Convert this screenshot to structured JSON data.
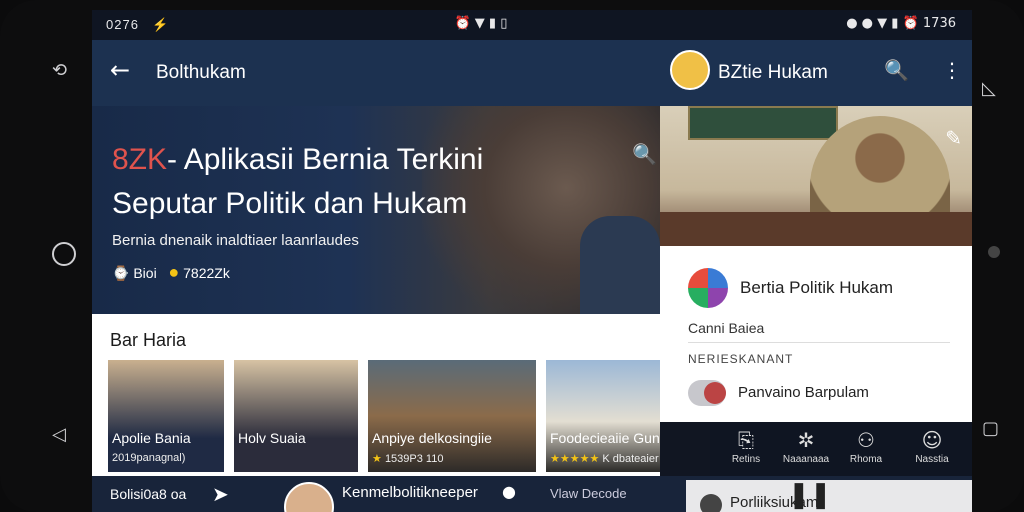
{
  "status_bar": {
    "time": "0276",
    "right_text": "1736"
  },
  "left": {
    "topbar_title": "Bolthukam",
    "hero": {
      "title_red": "8ZK",
      "title_rest": "- Aplikasii Bernia Terkini Seputar Politik dan Hukam",
      "subtitle": "Bernia dnenaik inaldtiaer laanrlaudes",
      "meta_left": "Bioi",
      "meta_right": "7822Zk"
    },
    "news_heading": "Bar Haria",
    "cards": [
      {
        "caption": "Apolie Bania",
        "sub": "2019panagnal)"
      },
      {
        "caption": "Holv Suaia",
        "sub": ""
      },
      {
        "caption": "Anpiye delkosingiie",
        "sub": "1539P3 110"
      },
      {
        "caption": "Foodecieaiie Gun",
        "sub": "K dbateaier"
      }
    ]
  },
  "bottom_bar": {
    "text1": "Bolisi0a8 oa",
    "text2": "Kenmelbolitikneeper",
    "text3": "Vlaw Decode",
    "pill_text": "Porliiksiukam"
  },
  "right": {
    "topbar_title": "BZtie Hukam",
    "panel": {
      "app_name": "Bertia Politik Hukam",
      "row1": "Canni Baiea",
      "row2": "NERIESKANANT",
      "row3": "Panvaino Barpulam"
    },
    "nav": [
      "Retins",
      "Naaanaaa",
      "Rhoma",
      "Nasstia"
    ]
  }
}
